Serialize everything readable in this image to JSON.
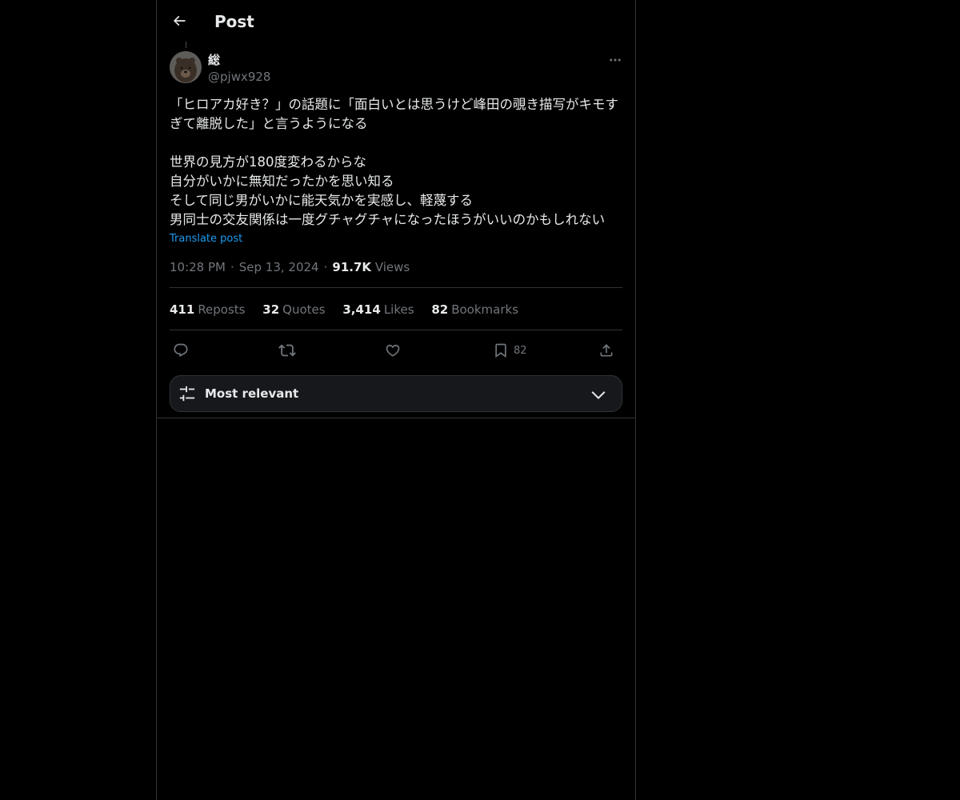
{
  "header": {
    "title": "Post"
  },
  "author": {
    "display_name": "総",
    "handle": "@pjwx928"
  },
  "tweet": {
    "text": "「ヒロアカ好き？」の話題に「面白いとは思うけど峰田の覗き描写がキモすぎて離脱した」と言うようになる\n\n世界の見方が180度変わるからな\n自分がいかに無知だったかを思い知る\nそして同じ男がいかに能天気かを実感し、軽蔑する\n男同士の交友関係は一度グチャグチャになったほうがいいのかもしれない",
    "translate_label": "Translate post"
  },
  "meta": {
    "time": "10:28 PM",
    "date": "Sep 13, 2024",
    "views_count": "91.7K",
    "views_label": "Views"
  },
  "stats": {
    "reposts_count": "411",
    "reposts_label": "Reposts",
    "quotes_count": "32",
    "quotes_label": "Quotes",
    "likes_count": "3,414",
    "likes_label": "Likes",
    "bookmarks_count": "82",
    "bookmarks_label": "Bookmarks"
  },
  "actions": {
    "reply_icon": "reply-icon",
    "repost_icon": "repost-icon",
    "like_icon": "heart-icon",
    "bookmark_icon": "bookmark-icon",
    "bookmark_count": "82",
    "share_icon": "share-icon"
  },
  "replies_sort": {
    "label": "Most relevant",
    "icon": "sliders-icon",
    "chevron": "chevron-down-icon"
  },
  "colors": {
    "background": "#000000",
    "text": "#e7e9ea",
    "muted": "#71767b",
    "link": "#1d9bf0",
    "border": "#2f3336"
  }
}
